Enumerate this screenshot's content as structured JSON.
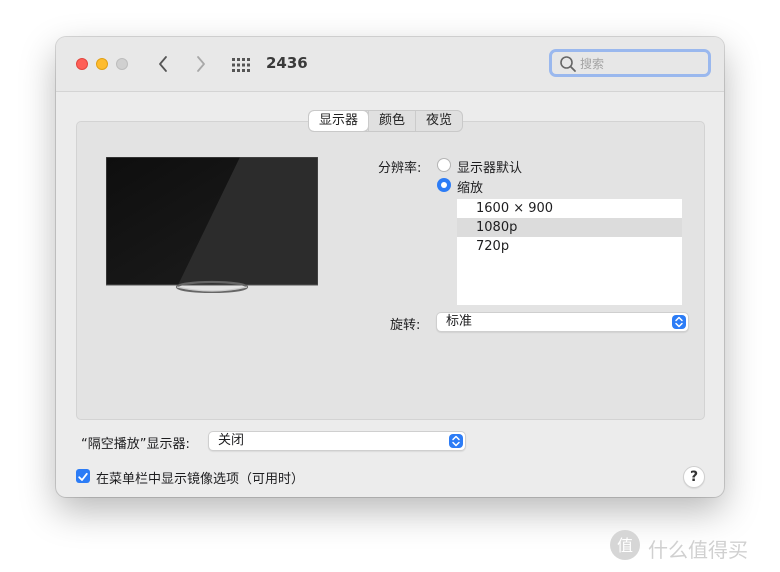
{
  "window": {
    "title": "2436"
  },
  "search": {
    "placeholder": "搜索"
  },
  "tabs": [
    {
      "label": "显示器",
      "active": true
    },
    {
      "label": "颜色",
      "active": false
    },
    {
      "label": "夜览",
      "active": false
    }
  ],
  "resolution": {
    "label": "分辨率:",
    "options": [
      {
        "label": "显示器默认",
        "selected": false
      },
      {
        "label": "缩放",
        "selected": true
      }
    ],
    "list": [
      {
        "label": "1600 × 900",
        "selected": false
      },
      {
        "label": "1080p",
        "selected": true
      },
      {
        "label": "720p",
        "selected": false
      }
    ]
  },
  "rotation": {
    "label": "旋转:",
    "value": "标准"
  },
  "airplay": {
    "label": "“隔空播放”显示器:",
    "value": "关闭"
  },
  "mirroring": {
    "label": "在菜单栏中显示镜像选项（可用时）",
    "checked": true
  },
  "help": {
    "label": "?"
  },
  "watermark": {
    "text": "什么值得买",
    "logo_text": "值"
  },
  "colors": {
    "accent": "#2c7cf6",
    "close": "#fe5f57",
    "minimize": "#febc2e"
  }
}
